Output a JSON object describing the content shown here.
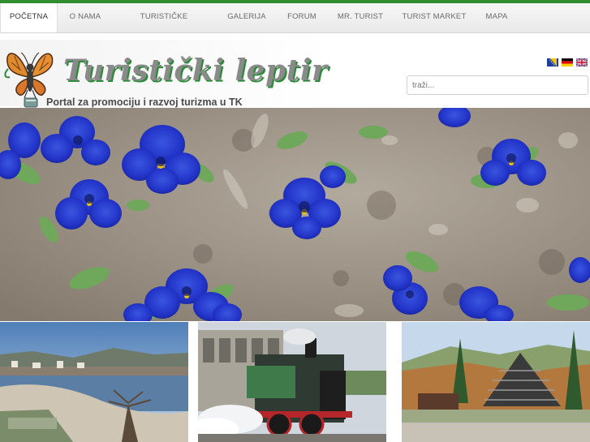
{
  "nav": {
    "items": [
      {
        "label": "POČETNA",
        "active": true
      },
      {
        "label": "O NAMA"
      },
      {
        "label": "TURISTIČKE ATRAKCIJE"
      },
      {
        "label": "GALERIJA"
      },
      {
        "label": "FORUM"
      },
      {
        "label": "MR. TURIST"
      },
      {
        "label": "TURIST MARKET"
      },
      {
        "label": "MAPA"
      }
    ]
  },
  "header": {
    "logo_title": "Turistički leptir",
    "tagline": "Portal za promociju i razvoj turizma u TK"
  },
  "languages": [
    "bosnian-flag-icon",
    "german-flag-icon",
    "english-flag-icon"
  ],
  "search": {
    "placeholder": "traži..."
  },
  "colors": {
    "accent": "#2f8f2f",
    "nav_text": "#6a6a6a"
  },
  "images": {
    "hero": "blue-pansies-photo",
    "thumbs": [
      "lake-beach-photo",
      "steam-locomotive-photo",
      "mountain-hotel-photo"
    ]
  }
}
